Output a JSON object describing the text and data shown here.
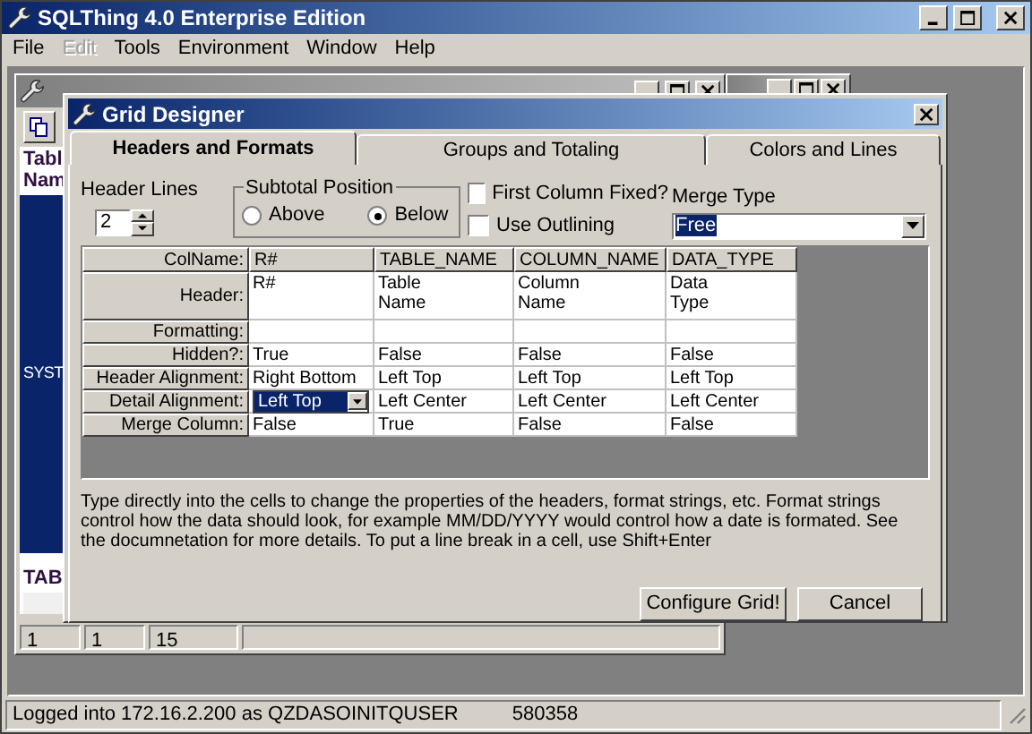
{
  "window": {
    "title": "SQLThing 4.0 Enterprise Edition"
  },
  "menu": [
    {
      "label": "File",
      "disabled": false
    },
    {
      "label": "Edit",
      "disabled": true
    },
    {
      "label": "Tools",
      "disabled": false
    },
    {
      "label": "Environment",
      "disabled": false
    },
    {
      "label": "Window",
      "disabled": false
    },
    {
      "label": "Help",
      "disabled": false
    }
  ],
  "child_window": {
    "pane_texts": [
      {
        "text": "Tabl",
        "kind": "heading"
      },
      {
        "text": "Nam",
        "kind": "heading"
      },
      {
        "text": "SYST",
        "kind": "item"
      },
      {
        "text": "TAB",
        "kind": "footer"
      }
    ],
    "status": [
      "1",
      "1",
      "15"
    ]
  },
  "dialog": {
    "title": "Grid Designer",
    "tabs": [
      {
        "label": "Headers and Formats",
        "selected": true
      },
      {
        "label": "Groups and Totaling",
        "selected": false
      },
      {
        "label": "Colors and Lines",
        "selected": false
      }
    ],
    "header_lines": {
      "label": "Header Lines",
      "value": "2"
    },
    "subtotal_position": {
      "label": "Subtotal Position",
      "options": [
        {
          "label": "Above",
          "selected": false
        },
        {
          "label": "Below",
          "selected": true
        }
      ]
    },
    "checkboxes": [
      {
        "label": "First Column Fixed?",
        "checked": false
      },
      {
        "label": "Use Outlining",
        "checked": false
      }
    ],
    "merge_type": {
      "label": "Merge Type",
      "value": "Free"
    },
    "grid": {
      "rows": [
        {
          "label": "ColName:",
          "kind": "names",
          "cells": [
            {
              "text": "R#",
              "selected": false
            },
            {
              "text": "TABLE_NAME",
              "selected": false
            },
            {
              "text": "COLUMN_NAME",
              "selected": false
            },
            {
              "text": "DATA_TYPE",
              "selected": false
            }
          ]
        },
        {
          "label": "Header:",
          "kind": "tall",
          "cells": [
            {
              "text": "R#",
              "selected": false
            },
            {
              "text": "Table\nName",
              "selected": false
            },
            {
              "text": "Column\nName",
              "selected": false
            },
            {
              "text": "Data\nType",
              "selected": false
            }
          ]
        },
        {
          "label": "Formatting:",
          "kind": "normal",
          "cells": [
            {
              "selected": false
            },
            {
              "selected": false
            },
            {
              "selected": false
            },
            {
              "selected": false
            }
          ]
        },
        {
          "label": "Hidden?:",
          "kind": "normal",
          "cells": [
            {
              "text": "True",
              "selected": false
            },
            {
              "text": "False",
              "selected": false
            },
            {
              "text": "False",
              "selected": false
            },
            {
              "text": "False",
              "selected": false
            }
          ]
        },
        {
          "label": "Header Alignment:",
          "kind": "normal",
          "cells": [
            {
              "text": "Right Bottom",
              "selected": false
            },
            {
              "text": "Left Top",
              "selected": false
            },
            {
              "text": "Left Top",
              "selected": false
            },
            {
              "text": "Left Top",
              "selected": false
            }
          ]
        },
        {
          "label": "Detail Alignment:",
          "kind": "normal",
          "cells": [
            {
              "text": "Left Top",
              "selected": true
            },
            {
              "text": "Left Center",
              "selected": false
            },
            {
              "text": "Left Center",
              "selected": false
            },
            {
              "text": "Left Center",
              "selected": false
            }
          ]
        },
        {
          "label": "Merge Column:",
          "kind": "normal",
          "cells": [
            {
              "text": "False",
              "selected": false
            },
            {
              "text": "True",
              "selected": false
            },
            {
              "text": "False",
              "selected": false
            },
            {
              "text": "False",
              "selected": false
            }
          ]
        }
      ]
    },
    "description": "Type directly into the cells to change the properties of the headers, format strings, etc.  Format strings control how the data should look, for example MM/DD/YYYY would control how a date is formated.  See the documnetation for more details.  To put a line break in a cell, use Shift+Enter",
    "buttons": [
      "Configure Grid!",
      "Cancel"
    ]
  },
  "status_bar": {
    "login": "Logged into 172.16.2.200 as QZDASOINITQUSER",
    "number": "580358"
  }
}
